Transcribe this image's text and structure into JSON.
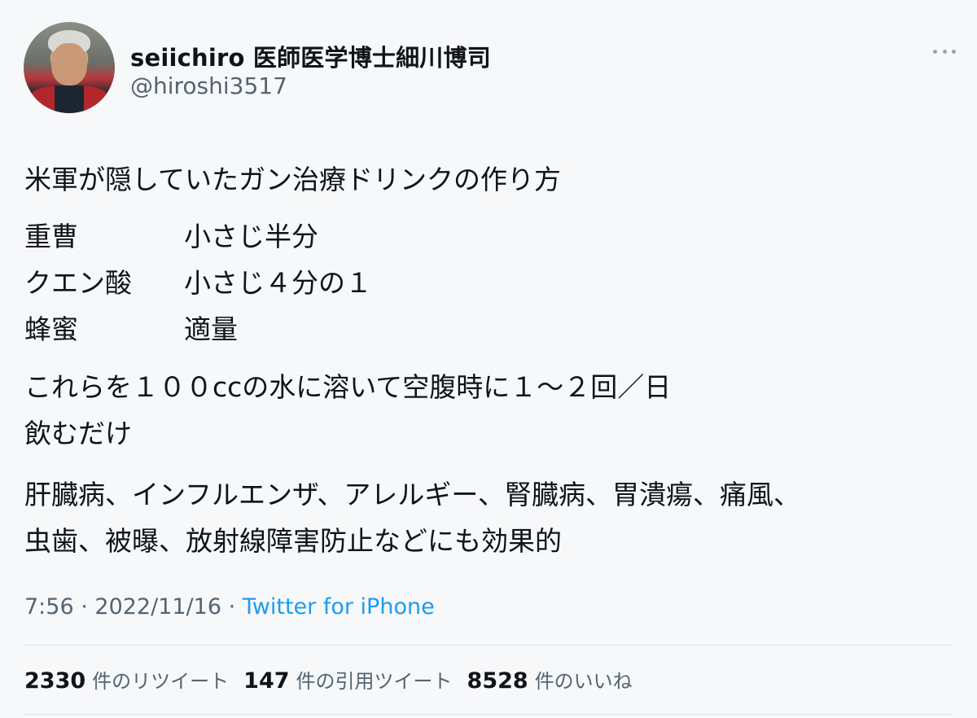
{
  "user": {
    "display_name": "seiichiro 医師医学博士細川博司",
    "handle": "@hiroshi3517"
  },
  "tweet": {
    "line1": "米軍が隠していたガン治療ドリンクの作り方",
    "ingredients": [
      {
        "name": "重曹",
        "amount": "小さじ半分"
      },
      {
        "name": "クエン酸",
        "amount": "小さじ４分の１"
      },
      {
        "name": "蜂蜜",
        "amount": "適量"
      }
    ],
    "para2_line1": "これらを１００ccの水に溶いて空腹時に１〜２回／日",
    "para2_line2": "飲むだけ",
    "para3_line1": "肝臓病、インフルエンザ、アレルギー、腎臓病、胃潰瘍、痛風、",
    "para3_line2": "虫歯、被曝、放射線障害防止などにも効果的"
  },
  "meta": {
    "time": "7:56",
    "sep1": " · ",
    "date": "2022/11/16",
    "sep2": " · ",
    "source": "Twitter for iPhone"
  },
  "stats": {
    "retweets": {
      "count": "2330",
      "label": "件のリツイート"
    },
    "quotes": {
      "count": "147",
      "label": "件の引用ツイート"
    },
    "likes": {
      "count": "8528",
      "label": "件のいいね"
    }
  },
  "icons": {
    "more": "more-horizontal-icon"
  }
}
